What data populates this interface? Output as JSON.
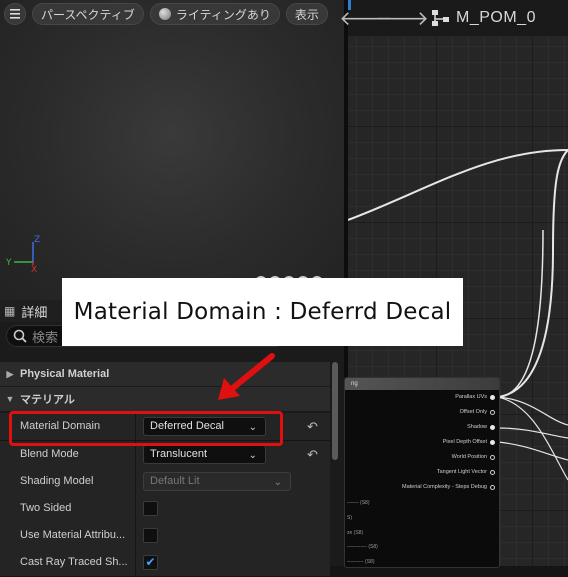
{
  "viewport": {
    "menu_icon": "hamburger-icon",
    "perspective_label": "パースペクティブ",
    "lighting_label": "ライティングあり",
    "show_label": "表示",
    "axis": {
      "z": "Z",
      "y": "Y",
      "x": "X"
    }
  },
  "graph": {
    "title": "M_POM_0",
    "back_icon": "arrow-left-icon",
    "forward_icon": "arrow-right-icon",
    "hierarchy_icon": "hierarchy-icon",
    "node_header": "ng",
    "pins": [
      {
        "label": "Parallax UVs",
        "filled": true
      },
      {
        "label": "Offset Only",
        "filled": false
      },
      {
        "label": "Shadow",
        "filled": true
      },
      {
        "label": "Pixel Depth Offset",
        "filled": true
      },
      {
        "label": "World Position",
        "filled": false
      },
      {
        "label": "Tangent Light Vector",
        "filled": false
      },
      {
        "label": "Material Complexity - Steps Debug",
        "filled": false
      }
    ],
    "left_labels": [
      "------- (S8)",
      "S)",
      "ze (S8)",
      "------------ (S8)",
      "---------- (S8)"
    ]
  },
  "details": {
    "title": "詳細",
    "search_placeholder": "検索",
    "section_physical": "Physical Material",
    "section_material": "マテリアル",
    "rows": [
      {
        "label": "Material Domain",
        "value": "Deferred Decal"
      },
      {
        "label": "Blend Mode",
        "value": "Translucent"
      },
      {
        "label": "Shading Model",
        "value": "Default Lit"
      },
      {
        "label": "Two Sided",
        "value": ""
      },
      {
        "label": "Use Material Attribu...",
        "value": ""
      },
      {
        "label": "Cast Ray Traced Sh...",
        "value": ""
      }
    ]
  },
  "annotation": {
    "text": "Material Domain : Deferrd Decal",
    "color": "#e01010"
  }
}
